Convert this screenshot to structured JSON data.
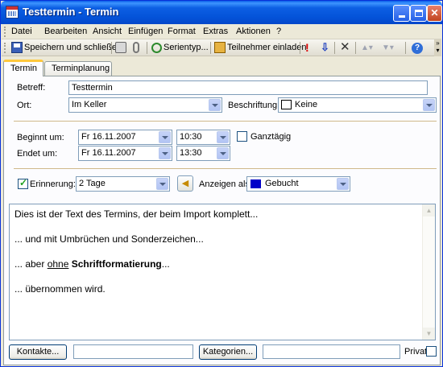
{
  "window": {
    "title": "Testtermin - Termin"
  },
  "menu": {
    "items": [
      "Datei",
      "Bearbeiten",
      "Ansicht",
      "Einfügen",
      "Format",
      "Extras",
      "Aktionen",
      "?"
    ]
  },
  "toolbar": {
    "save_close": "Speichern und schließen",
    "recurrence": "Serientyp...",
    "invite": "Teilnehmer einladen"
  },
  "tabs": [
    "Termin",
    "Terminplanung"
  ],
  "form": {
    "subject_label": "Betreff:",
    "subject_value": "Testtermin",
    "location_label": "Ort:",
    "location_value": "Im Keller",
    "category_label": "Beschriftung:",
    "category_value": "Keine",
    "start_label": "Beginnt um:",
    "start_date": "Fr 16.11.2007",
    "start_time": "10:30",
    "end_label": "Endet um:",
    "end_date": "Fr 16.11.2007",
    "end_time": "13:30",
    "allday_label": "Ganztägig",
    "allday_checked": false,
    "reminder_label": "Erinnerung:",
    "reminder_checked": true,
    "reminder_value": "2 Tage",
    "showas_label": "Anzeigen als:",
    "showas_value": "Gebucht",
    "showas_color": "#0000c8"
  },
  "body": {
    "line1": "Dies ist der Text des Termins, der beim Import komplett...",
    "line2": "... und mit Umbrüchen und Sonderzeichen...",
    "line3_prefix": "... aber ",
    "line3_underline": "ohne",
    "line3_space": " ",
    "line3_bold": "Schriftformatierung",
    "line3_suffix": "...",
    "line4": "... übernommen wird."
  },
  "footer": {
    "contacts_button": "Kontakte...",
    "contacts_value": "",
    "categories_button": "Kategorien...",
    "categories_value": "",
    "private_label": "Privat",
    "private_checked": false
  },
  "colors": {
    "titlebar": "#0453d9",
    "accent_tab": "#ffc83c"
  }
}
